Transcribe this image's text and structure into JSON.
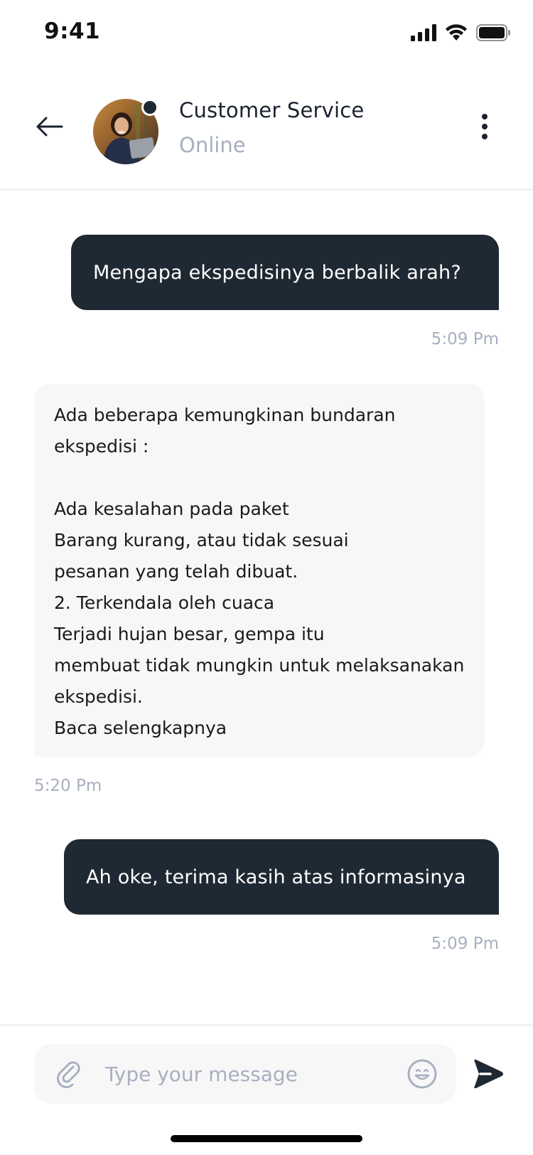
{
  "status_bar": {
    "time": "9:41"
  },
  "header": {
    "contact_name": "Customer Service",
    "contact_status": "Online"
  },
  "messages": [
    {
      "direction": "outgoing",
      "text": "Mengapa ekspedisinya berbalik arah?",
      "time": "5:09 Pm"
    },
    {
      "direction": "incoming",
      "text": "Ada beberapa kemungkinan bundaran\nekspedisi :\n\nAda kesalahan pada paket\nBarang kurang, atau tidak sesuai\npesanan yang telah dibuat.\n  2. Terkendala oleh cuaca\nTerjadi hujan besar, gempa itu\nmembuat tidak mungkin untuk melaksanakan\nekspedisi.\nBaca selengkapnya",
      "time": "5:20 Pm"
    },
    {
      "direction": "outgoing",
      "text": "Ah oke, terima kasih atas informasinya",
      "time": "5:09 Pm"
    }
  ],
  "composer": {
    "placeholder": "Type your message"
  },
  "icons": {
    "back": "arrow-left-icon",
    "more": "more-vertical-icon",
    "attach": "paperclip-icon",
    "emoji": "smiley-icon",
    "send": "send-icon"
  },
  "colors": {
    "outgoing_bubble": "#1f2933",
    "incoming_bubble": "#f7f7f7",
    "muted_text": "#a8afc0",
    "online_indicator": "#1f2933"
  }
}
